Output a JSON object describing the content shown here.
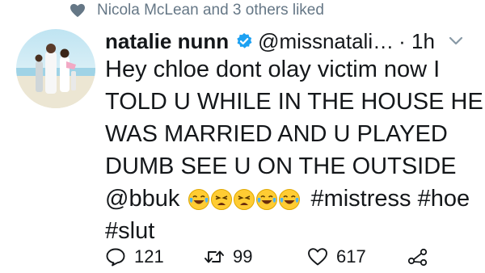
{
  "context": {
    "icon": "heart-icon",
    "text": "Nicola McLean and 3 others liked"
  },
  "tweet": {
    "author_name": "natalie nunn",
    "handle": "@missnatali…",
    "time": "· 1h",
    "lines": [
      "Hey chloe dont olay victim now I",
      "TOLD U WHILE IN THE HOUSE HE",
      "WAS MARRIED AND U PLAYED",
      "DUMB SEE U ON THE OUTSIDE"
    ],
    "mention": "@bbuk",
    "emojis": [
      "tears-of-joy",
      "weary-face",
      "weary-face",
      "tears-of-joy",
      "tears-of-joy"
    ],
    "hashtags_inline": "#mistress #hoe",
    "hashtag_last": "#slut"
  },
  "actions": {
    "replies": "121",
    "retweets": "99",
    "likes": "617"
  },
  "colors": {
    "muted": "#657786",
    "verified": "#1da1f2",
    "text": "#14171a"
  }
}
